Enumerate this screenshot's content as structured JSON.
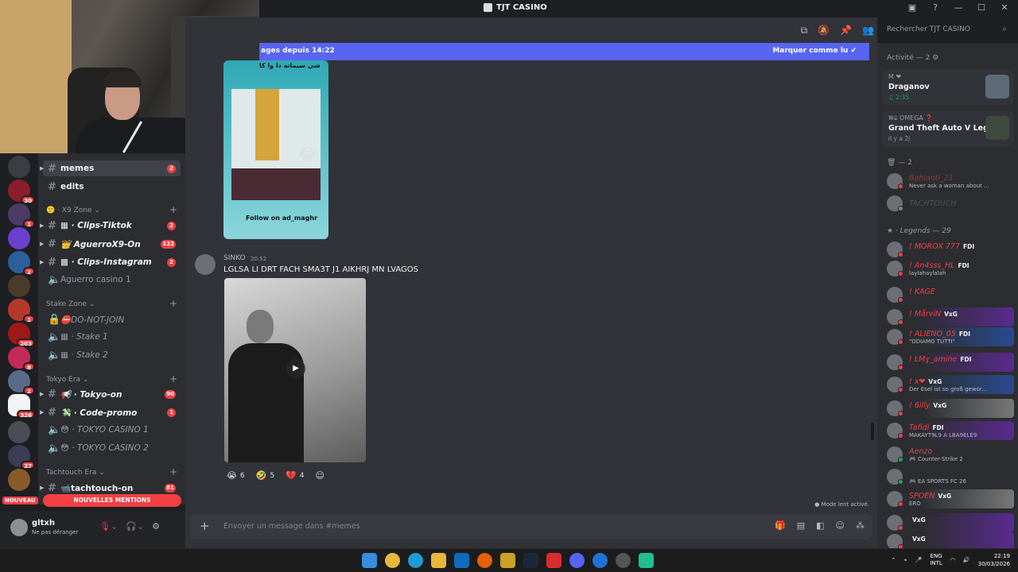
{
  "window": {
    "title": "TJT CASINO",
    "controls": [
      "▣",
      "?",
      "—",
      "☐",
      "✕"
    ]
  },
  "server_badges": [
    "30",
    "1",
    "2",
    "1",
    "203",
    "8",
    "2",
    "326",
    "27"
  ],
  "channels": {
    "items": [
      {
        "name": "memes",
        "badge": "2"
      },
      {
        "name": "edits",
        "badge": ""
      },
      {
        "name": "Clips-Tiktok",
        "badge": "2"
      },
      {
        "name": "AguerroX9-On",
        "badge": "122"
      },
      {
        "name": "Clips-Instagram",
        "badge": "2"
      },
      {
        "name": "Aguerro casino 1"
      },
      {
        "name": "DO-NOT-JOIN"
      },
      {
        "name": "Stake 1"
      },
      {
        "name": "Stake 2"
      },
      {
        "name": "Tokyo-on",
        "badge": "90"
      },
      {
        "name": "Code-promo",
        "badge": "1"
      },
      {
        "name": "TOKYO CASINO 1"
      },
      {
        "name": "TOKYO CASINO 2"
      },
      {
        "name": "tachtouch-on",
        "badge": "81"
      }
    ],
    "categories": [
      "X9 Zone",
      "Stake Zone",
      "Tokyo Era",
      "Tachtouch Era"
    ],
    "nouveau": "NOUVEAU",
    "mentions": "NOUVELLES MENTIONS"
  },
  "user": {
    "name": "gltxh",
    "status": "Ne pas déranger"
  },
  "chat": {
    "new_bar_left": "ages depuis 14:22",
    "new_bar_right": "Marquer comme lu",
    "media_top_text": "شي سيماته دا وا كا",
    "media_follow": "Follow on",
    "media_handle": "ad_maghr",
    "author": "SINKO",
    "time": "20:52",
    "message": "LGLSA LI DRT FACH SMA3T J1 AIKHRJ MN LVAGOS",
    "reactions": [
      {
        "emoji": "😭",
        "count": "6"
      },
      {
        "emoji": "🤣",
        "count": "5"
      },
      {
        "emoji": "💔",
        "count": "4"
      },
      {
        "emoji": "☺",
        "count": ""
      }
    ],
    "slow_mode": "Mode lent activé.",
    "placeholder": "Envoyer un message dans #memes"
  },
  "search_placeholder": "Rechercher TJT CASINO",
  "members": {
    "activity_header": "Activité — 2",
    "activities": [
      {
        "small": "M ❤",
        "title": "Draganov",
        "meta": "♫ 2:35"
      },
      {
        "small": "𝕹𝕾 OMEGA ❓",
        "title": "Grand Theft Auto V Legacy",
        "meta": "il y a 2j"
      }
    ],
    "group1_header": "— 2",
    "group1": [
      {
        "name": "Bahlaoti_21",
        "status": "Never ask a woman about ..."
      },
      {
        "name": "TACHTOUCH",
        "status": ""
      }
    ],
    "legends_header": "Legends — 29",
    "legends": [
      {
        "name": "! MOROX 777",
        "tag": "FDI",
        "status": ""
      },
      {
        "name": "! An4sss_HL",
        "tag": "FDI",
        "status": "laylahaylalah"
      },
      {
        "name": "! KAGE",
        "tag": "",
        "status": ""
      },
      {
        "name": "! MårviN",
        "tag": "VxG",
        "status": ""
      },
      {
        "name": "! ALIENO_05",
        "tag": "FDI",
        "status": "\"ODIAMO TUTTI\""
      },
      {
        "name": "! ĿMɣ_amine",
        "tag": "FDI",
        "status": ""
      },
      {
        "name": "! x❤",
        "tag": "VxG",
        "status": "Der Esel ist so groß gewor..."
      },
      {
        "name": "! 6illy",
        "tag": "VxG",
        "status": ""
      },
      {
        "name": "Tafidi",
        "tag": "FDI",
        "status": "MAKAYT9L9 A LBA9ELE9"
      },
      {
        "name": "Aenzo",
        "tag": "",
        "status": "Counter-Strike 2"
      },
      {
        "name": "",
        "tag": "",
        "status": "EA SPORTS FC 26"
      },
      {
        "name": "SPOEN",
        "tag": "VxG",
        "status": "ERO"
      },
      {
        "name": "",
        "tag": "VxG",
        "status": ""
      },
      {
        "name": "",
        "tag": "VxG",
        "status": ""
      }
    ]
  },
  "taskbar": {
    "lang1": "ENG",
    "lang2": "INTL",
    "time": "22:19",
    "date": "30/03/2026"
  },
  "colors": {
    "accent": "#5865f2",
    "danger": "#f23f43",
    "online": "#23a55a"
  }
}
